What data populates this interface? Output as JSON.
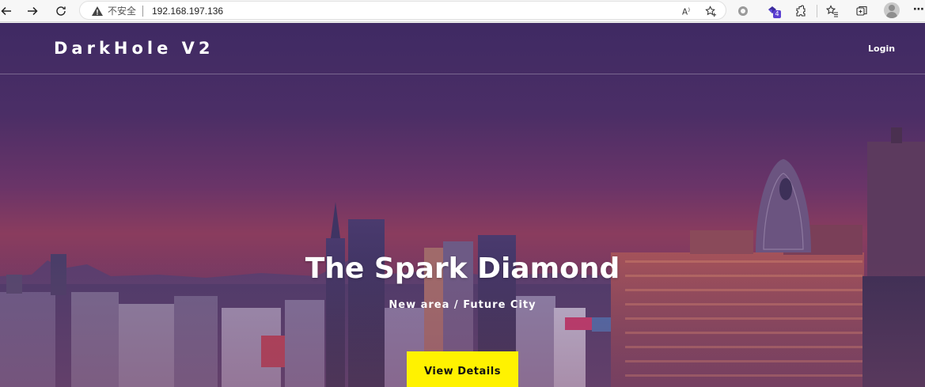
{
  "browser": {
    "security_label": "不安全",
    "url": "192.168.197.136",
    "extension_badge": "4",
    "icons": [
      "back-arrow-icon",
      "forward-arrow-icon",
      "refresh-icon",
      "warning-icon",
      "read-aloud-icon",
      "add-favorite-icon",
      "circle-extension-icon",
      "extension-badge-icon",
      "puzzle-extensions-icon",
      "favorites-icon",
      "collections-icon",
      "profile-avatar-icon",
      "more-menu-icon"
    ]
  },
  "site": {
    "logo": "DarkHole V2",
    "nav": {
      "login_label": "Login"
    }
  },
  "hero": {
    "title": "The Spark Diamond",
    "subtitle": "New area / Future City",
    "cta_label": "View Details"
  },
  "colors": {
    "accent": "#fff200",
    "overlay": "#4b2e66",
    "text": "#ffffff"
  }
}
